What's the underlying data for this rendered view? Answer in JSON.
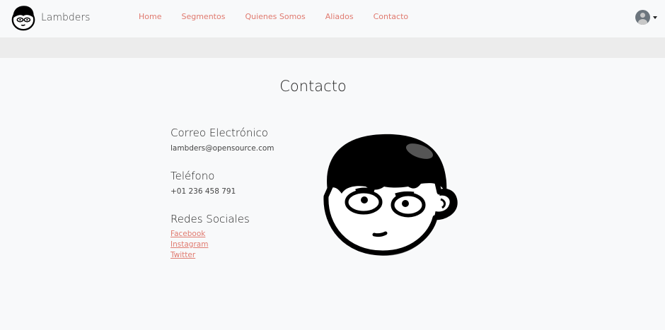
{
  "brand": {
    "name": "Lambders"
  },
  "nav": {
    "items": [
      {
        "label": "Home"
      },
      {
        "label": "Segmentos"
      },
      {
        "label": "Quienes Somos"
      },
      {
        "label": "Aliados"
      },
      {
        "label": "Contacto"
      }
    ]
  },
  "page": {
    "title": "Contacto"
  },
  "contact": {
    "email": {
      "heading": "Correo Electrónico",
      "value": "lambders@opensource.com"
    },
    "phone": {
      "heading": "Teléfono",
      "value": "+01 236 458 791"
    },
    "social": {
      "heading": "Redes Sociales",
      "links": [
        {
          "label": "Facebook"
        },
        {
          "label": "Instagram"
        },
        {
          "label": "Twitter"
        }
      ]
    }
  },
  "colors": {
    "accent": "#e07a6f",
    "navbar_bg": "#f8f9fa",
    "band_bg": "#ececec"
  },
  "icons": {
    "user_avatar": "user-avatar-icon",
    "dropdown": "caret-down-icon"
  }
}
